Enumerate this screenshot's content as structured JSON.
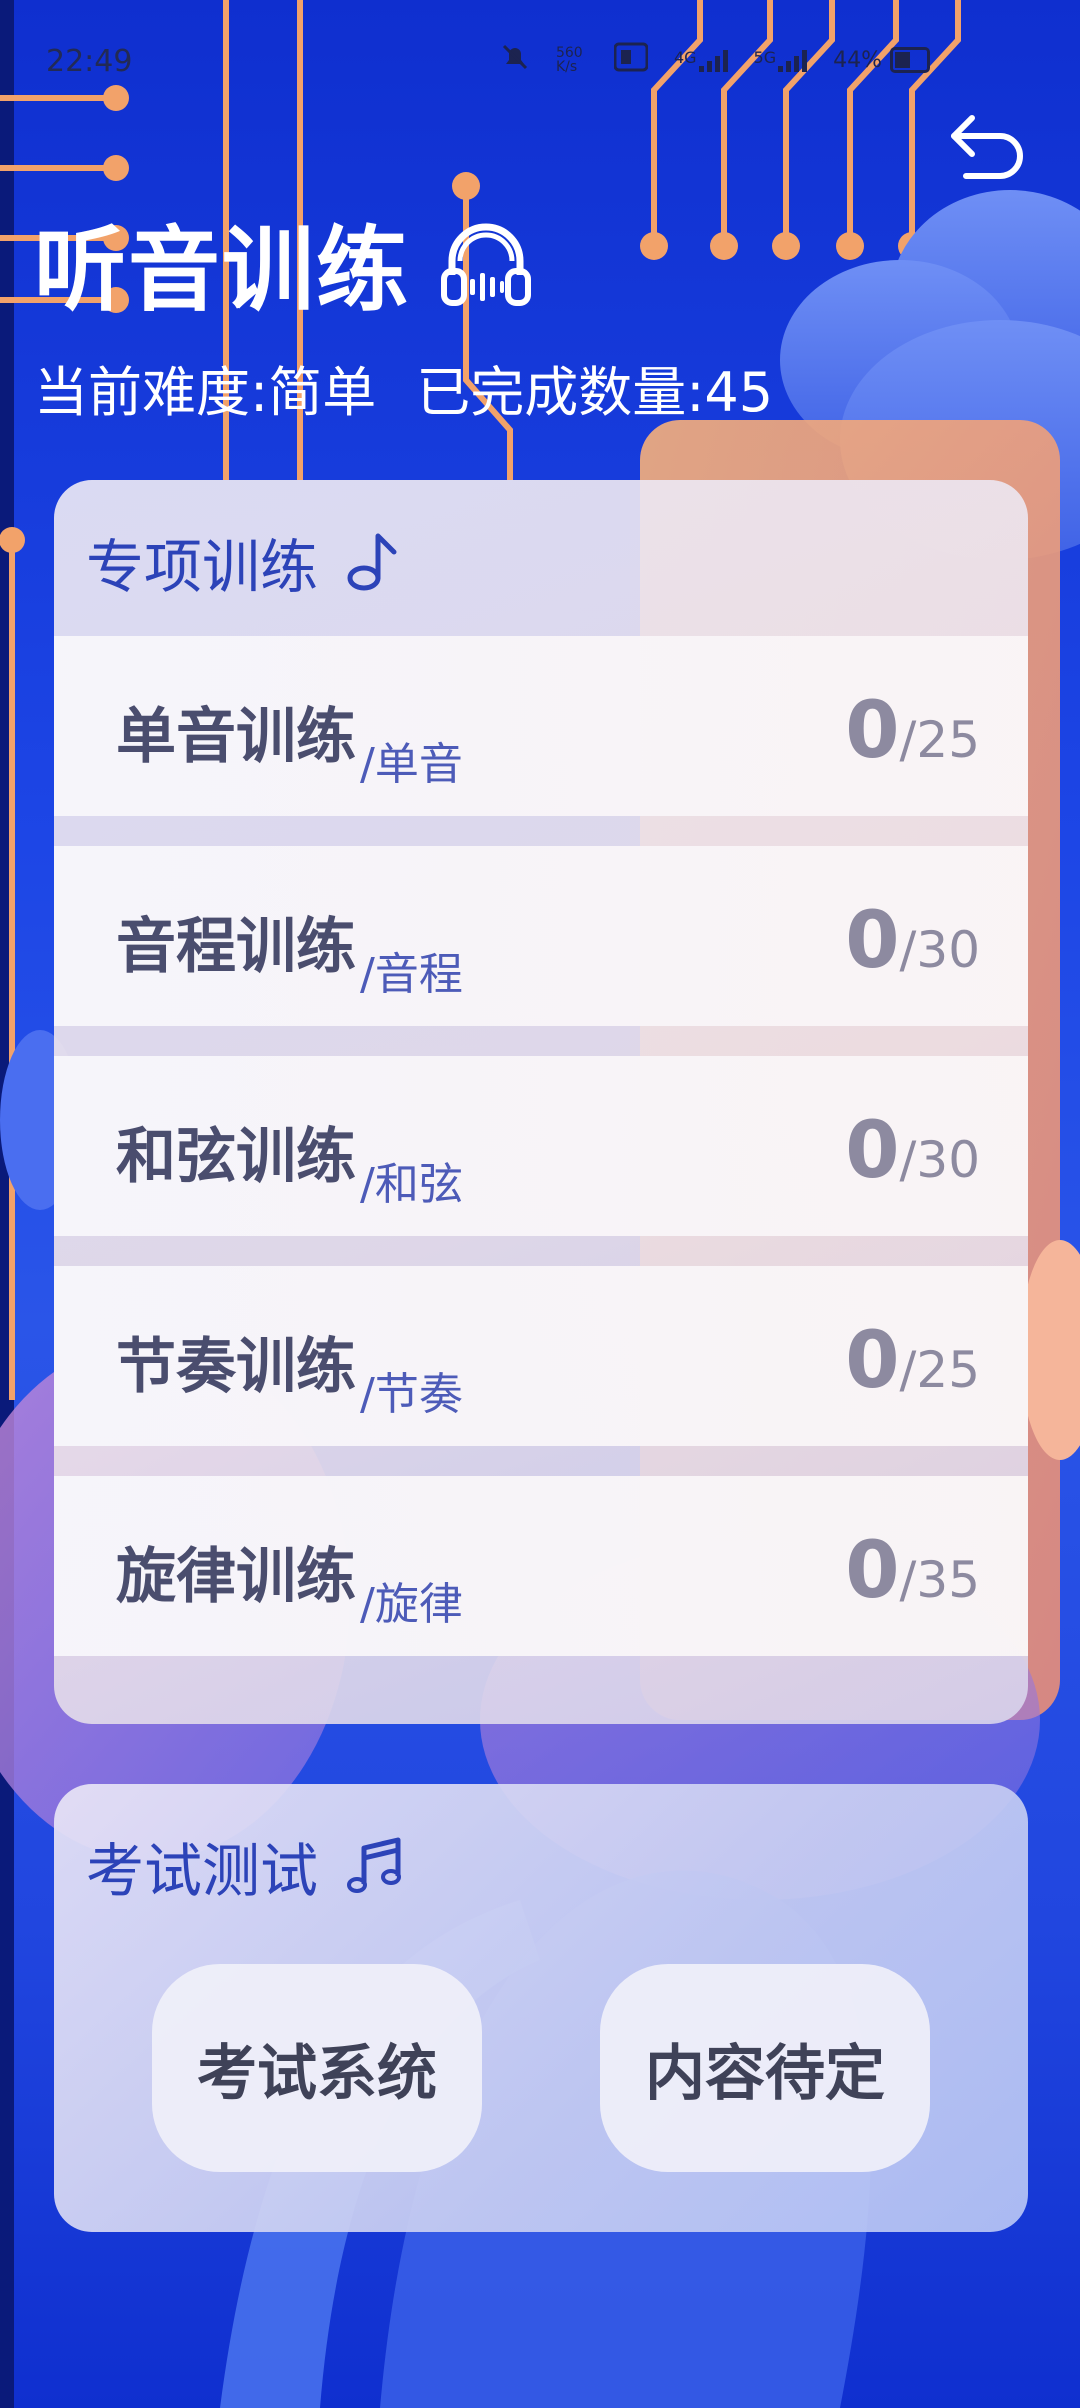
{
  "status_bar": {
    "time": "22:49",
    "icons": [
      "mute-bell-icon",
      "data-speed-icon",
      "hd-icon",
      "4g-signal-icon",
      "5g-signal-icon",
      "battery-icon"
    ],
    "speed_text": "560\nK/s",
    "network_4g": "4G",
    "network_5g": "5G",
    "battery": "44%"
  },
  "header": {
    "title": "听音训练",
    "difficulty": "当前难度:简单",
    "completed": "已完成数量:45"
  },
  "special_training": {
    "title": "专项训练",
    "items": [
      {
        "label": "单音训练",
        "sub": "/单音",
        "done": "0",
        "total": "/25"
      },
      {
        "label": "音程训练",
        "sub": "/音程",
        "done": "0",
        "total": "/30"
      },
      {
        "label": "和弦训练",
        "sub": "/和弦",
        "done": "0",
        "total": "/30"
      },
      {
        "label": "节奏训练",
        "sub": "/节奏",
        "done": "0",
        "total": "/25"
      },
      {
        "label": "旋律训练",
        "sub": "/旋律",
        "done": "0",
        "total": "/35"
      }
    ]
  },
  "exam": {
    "title": "考试测试",
    "buttons": [
      "考试系统",
      "内容待定"
    ]
  },
  "colors": {
    "background": "#1d46e6",
    "card_title": "#2c43b8",
    "row_label": "#4a4d6e",
    "row_sub": "#4d5bb8",
    "score": "#8d8aa0",
    "circuit": "#f2a26a"
  }
}
